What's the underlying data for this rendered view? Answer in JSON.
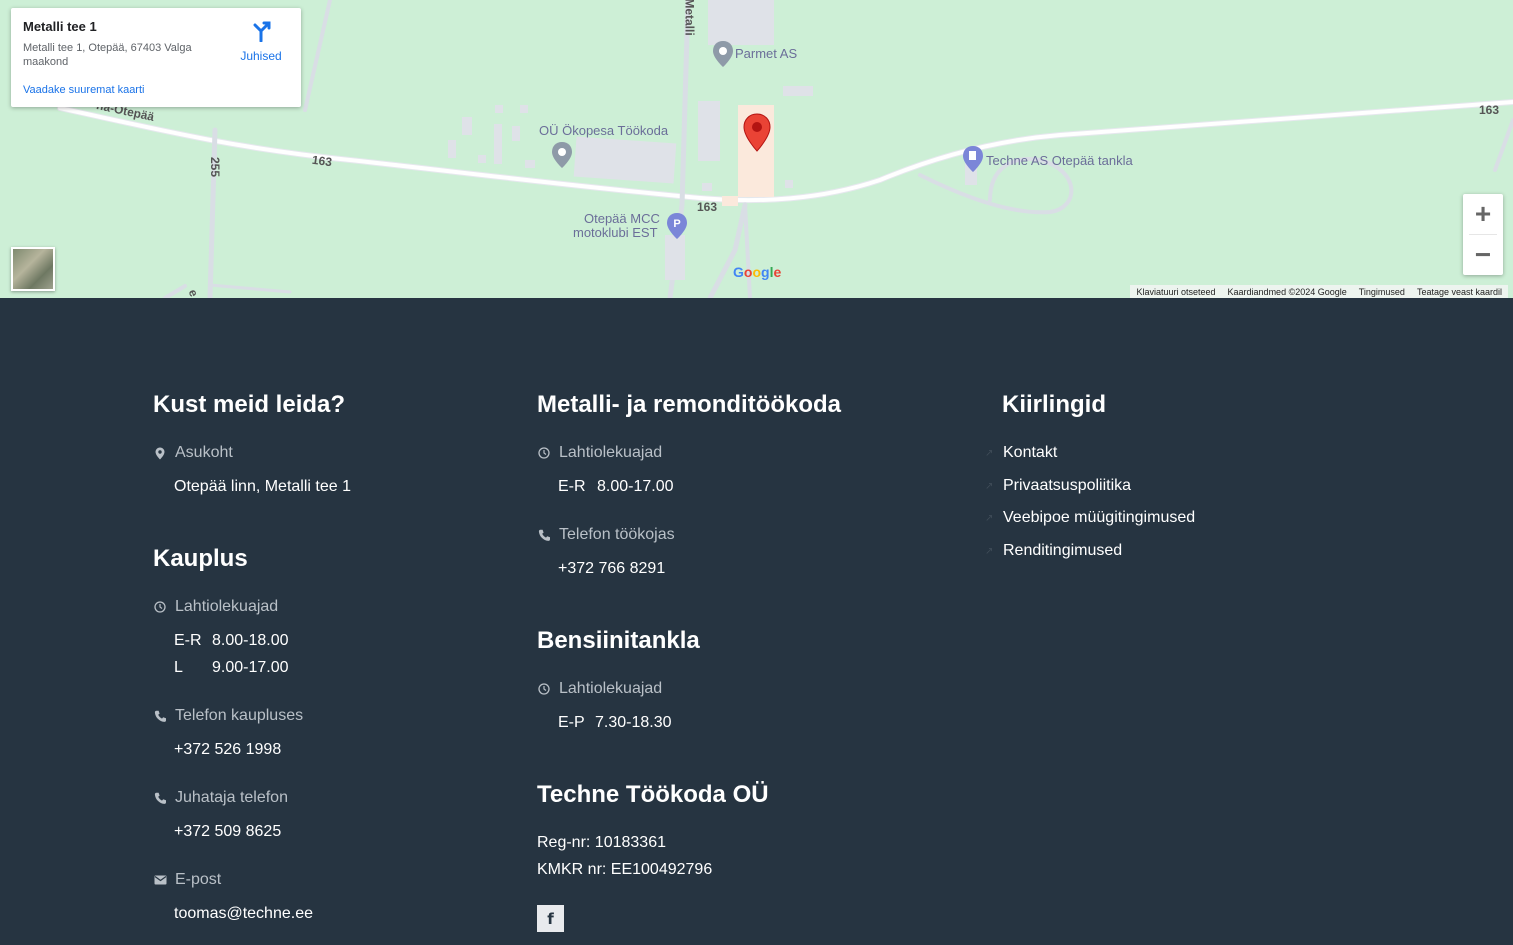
{
  "map": {
    "info_card": {
      "title": "Metalli tee 1",
      "address": "Metalli tee 1, Otepää, 67403 Valga maakond",
      "larger_map_link": "Vaadake suuremat kaarti",
      "directions_label": "Juhised"
    },
    "poi": {
      "parmet": "Parmet AS",
      "okopesa": "OÜ Ökopesa Töökoda",
      "techne_tankla": "Techne AS Otepää tankla",
      "mcc_line1": "Otepää MCC",
      "mcc_line2": "motoklubi EST"
    },
    "road_labels": {
      "road_163_a": "163",
      "road_163_b": "163",
      "road_163_c": "163",
      "road_255": "255",
      "road_name": "na-Otepää",
      "metalli": "Metalli",
      "edge": "e"
    },
    "zoom_in": "+",
    "zoom_out": "−",
    "google_logo": "Google",
    "attribution": {
      "keyboard": "Klaviatuuri otseteed",
      "map_data": "Kaardiandmed ©2024 Google",
      "terms": "Tingimused",
      "report": "Teatage veast kaardil"
    }
  },
  "footer": {
    "col1": {
      "heading": "Kust meid leida?",
      "location_label": "Asukoht",
      "location_value": "Otepää linn, Metalli tee 1",
      "shop_heading": "Kauplus",
      "shop_hours_label": "Lahtiolekuajad",
      "shop_hours": [
        {
          "days": "E-R",
          "time": "8.00-18.00"
        },
        {
          "days": "L",
          "time": "9.00-17.00"
        }
      ],
      "shop_phone_label": "Telefon kaupluses",
      "shop_phone": "+372 526 1998",
      "manager_phone_label": "Juhataja telefon",
      "manager_phone": "+372 509 8625",
      "email_label": "E-post",
      "email": "toomas@techne.ee"
    },
    "col2": {
      "heading": "Metalli- ja remonditöökoda",
      "hours_label": "Lahtiolekuajad",
      "hours": {
        "days": "E-R",
        "time": "8.00-17.00"
      },
      "phone_label": "Telefon töökojas",
      "phone": "+372 766 8291",
      "station_heading": "Bensiinitankla",
      "station_hours_label": "Lahtiolekuajad",
      "station_hours": {
        "days": "E-P",
        "time": "7.30-18.30"
      },
      "company_heading": "Techne Töökoda OÜ",
      "reg_nr": "Reg-nr: 10183361",
      "kmkr_nr": "KMKR nr: EE100492796",
      "facebook": "f"
    },
    "col3": {
      "heading": "Kiirlingid",
      "links": [
        "Kontakt",
        "Privaatsuspoliitika",
        "Veebipoe müügitingimused",
        "Renditingimused"
      ]
    }
  }
}
